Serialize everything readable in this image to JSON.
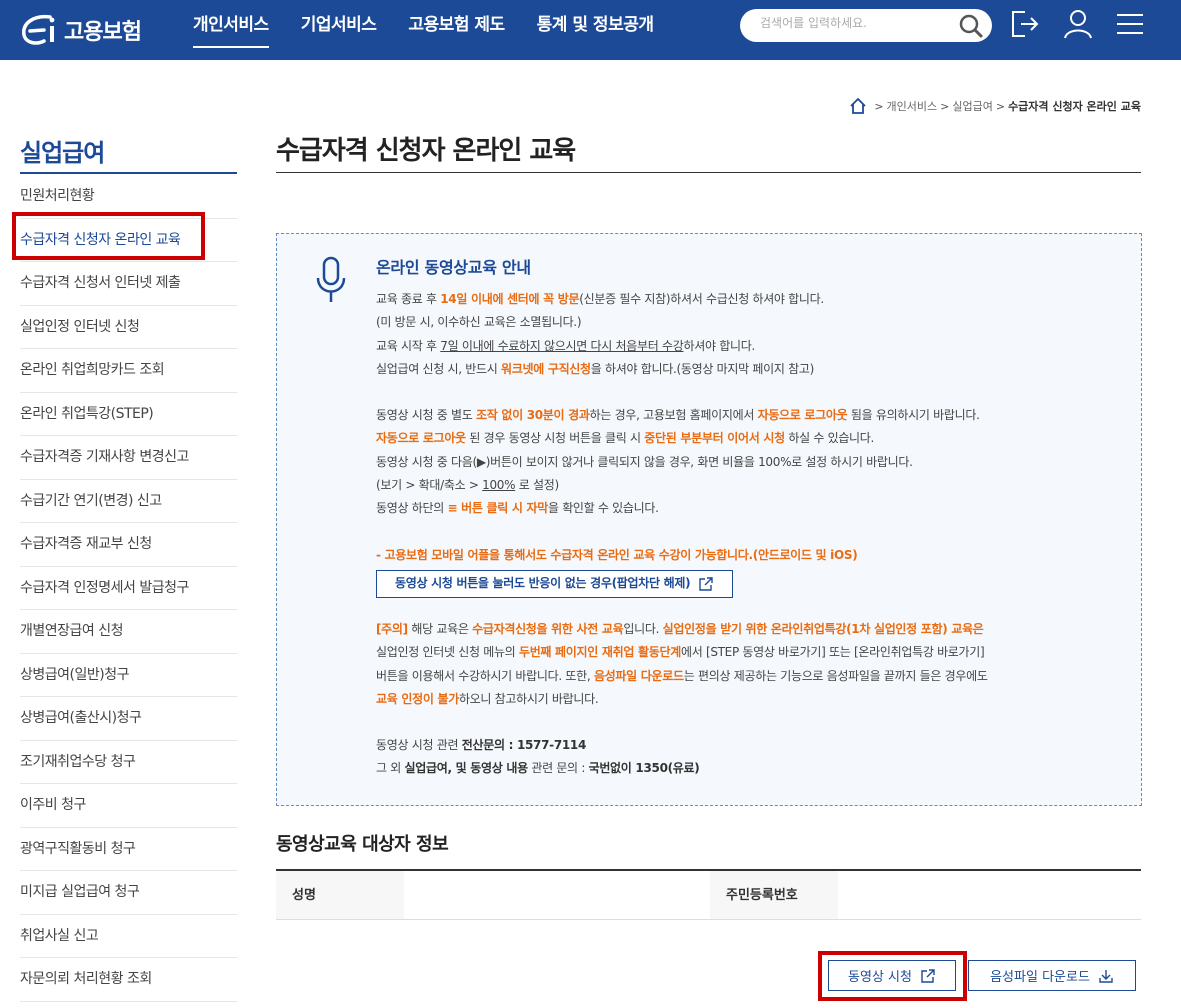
{
  "header": {
    "logo_text": "고용보험",
    "nav": [
      "개인서비스",
      "기업서비스",
      "고용보험 제도",
      "통계 및 정보공개"
    ],
    "search_placeholder": "검색어를 입력하세요."
  },
  "breadcrumb": {
    "items": [
      "개인서비스",
      "실업급여"
    ],
    "current": "수급자격 신청자 온라인 교육"
  },
  "sidebar": {
    "title": "실업급여",
    "items": [
      "민원처리현황",
      "수급자격 신청자 온라인 교육",
      "수급자격 신청서 인터넷 제출",
      "실업인정 인터넷 신청",
      "온라인 취업희망카드 조회",
      "온라인 취업특강(STEP)",
      "수급자격증 기재사항 변경신고",
      "수급기간 연기(변경) 신고",
      "수급자격증 재교부 신청",
      "수급자격 인정명세서 발급청구",
      "개별연장급여 신청",
      "상병급여(일반)청구",
      "상병급여(출산시)청구",
      "조기재취업수당 청구",
      "이주비 청구",
      "광역구직활동비 청구",
      "미지급 실업급여 청구",
      "취업사실 신고",
      "자문의뢰 처리현황 조회"
    ]
  },
  "page": {
    "title": "수급자격 신청자 온라인 교육"
  },
  "info": {
    "heading": "온라인 동영상교육 안내",
    "p1a": "교육 종료 후 ",
    "p1b": "14일 이내에 센터에 꼭 방문",
    "p1c": "(신분증 필수 지참)하셔서 수급신청 하셔야 합니다.",
    "p2": "(미 방문 시, 이수하신 교육은 소멸됩니다.)",
    "p3a": "교육 시작 후 ",
    "p3b": "7일 이내에 수료하지 않으시면 다시 처음부터 수강",
    "p3c": "하셔야 합니다.",
    "p4a": "실업급여 신청 시, 반드시 ",
    "p4b": "워크넷에 구직신청",
    "p4c": "을 하셔야 합니다.(동영상 마지막 페이지 참고)",
    "p5a": "동영상 시청 중 별도 ",
    "p5b": "조작 없이 30분이 경과",
    "p5c": "하는 경우, 고용보험 홈페이지에서 ",
    "p5d": "자동으로 로그아웃",
    "p5e": " 됨을 유의하시기 바랍니다.",
    "p6a": "자동으로 로그아웃",
    "p6b": " 된 경우 동영상 시청 버튼을 클릭 시 ",
    "p6c": "중단된 부분부터 이어서 시청",
    "p6d": " 하실 수 있습니다.",
    "p7": "동영상 시청 중 다음(▶)버튼이 보이지 않거나 클릭되지 않을 경우, 화면 비율을 100%로 설정 하시기 바랍니다.",
    "p8a": "(보기 > 확대/축소 > ",
    "p8b": "100%",
    "p8c": " 로 설정)",
    "p9a": "동영상 하단의 ",
    "p9b": "≡ 버튼 클릭 시 자막",
    "p9c": "을 확인할 수 있습니다.",
    "mobile": "- 고용보험 모바일 어플을 통해서도 수급자격 온라인 교육 수강이 가능합니다.(안드로이드 및 iOS)",
    "popup_button": "동영상 시청 버튼을 눌러도 반응이 없는 경우(팝업차단 해제)",
    "n1a": "[주의]",
    "n1b": " 해당 교육은 ",
    "n1c": "수급자격신청을 위한 사전 교육",
    "n1d": "입니다. ",
    "n1e": "실업인정을 받기 위한 온라인취업특강(1차 실업인정 포함) 교육은",
    "n2a": "실업인정 인터넷 신청 메뉴의 ",
    "n2b": "두번째 페이지인 재취업 활동단계",
    "n2c": "에서 [STEP 동영상 바로가기] 또는 [온라인취업특강 바로가기]",
    "n3a": "버튼을 이용해서 수강하시기 바랍니다. 또한, ",
    "n3b": "음성파일 다운로드",
    "n3c": "는 편의상 제공하는 기능으로 음성파일을 끝까지 들은 경우에도",
    "n4a": "교육 인정이 불가",
    "n4b": "하오니 참고하시기 바랍니다.",
    "c1a": "동영상 시청 관련 ",
    "c1b": "전산문의 : 1577-7114",
    "c2a": "그 외 ",
    "c2b": "실업급여, 및 동영상 내용",
    "c2c": " 관련 문의 : ",
    "c2d": "국번없이 1350(유료)"
  },
  "target": {
    "section_title": "동영상교육 대상자 정보",
    "name_header": "성명",
    "name_value": "",
    "id_header": "주민등록번호",
    "id_value": ""
  },
  "buttons": {
    "watch": "동영상 시청",
    "audio": "음성파일 다운로드"
  },
  "colors": {
    "brand": "#1c4a97",
    "accent": "#e96b12",
    "highlight": "#cc0000"
  }
}
